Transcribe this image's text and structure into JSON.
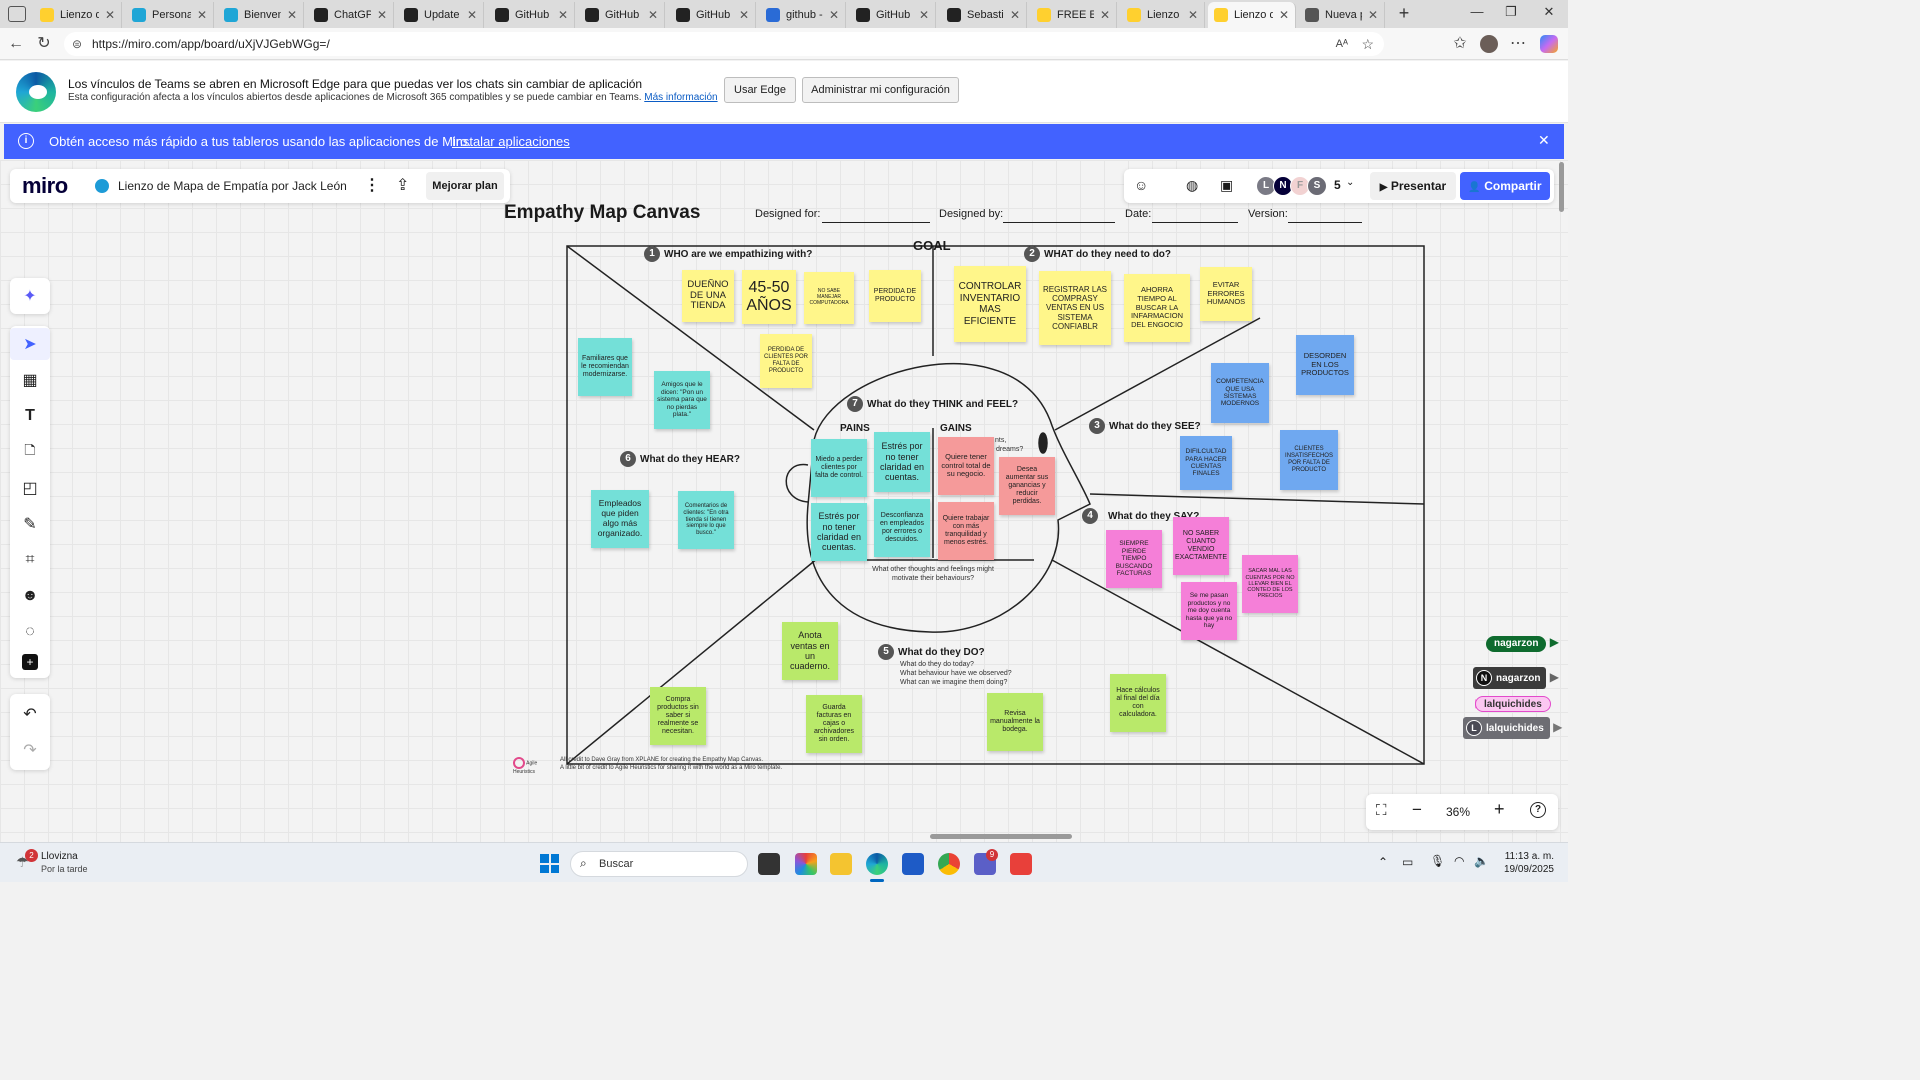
{
  "browser": {
    "tabs": [
      {
        "title": "Lienzo de",
        "icon": "miro-favicon",
        "color": "#ffd02f"
      },
      {
        "title": "Personali",
        "icon": "edge-favicon",
        "color": "#1fa6d6"
      },
      {
        "title": "Bienvenid",
        "icon": "edge-favicon",
        "color": "#1fa6d6"
      },
      {
        "title": "ChatGPT",
        "icon": "chatgpt-favicon",
        "color": "#222222"
      },
      {
        "title": "Update h",
        "icon": "github-favicon",
        "color": "#222222"
      },
      {
        "title": "GitHub -",
        "icon": "github-favicon",
        "color": "#222222"
      },
      {
        "title": "GitHub -",
        "icon": "github-favicon",
        "color": "#222222"
      },
      {
        "title": "GitHub -",
        "icon": "github-favicon",
        "color": "#222222"
      },
      {
        "title": "github - E",
        "icon": "search-favicon",
        "color": "#2a6bd6"
      },
      {
        "title": "GitHub",
        "icon": "github-favicon",
        "color": "#222222"
      },
      {
        "title": "Sebastian",
        "icon": "github-favicon",
        "color": "#222222"
      },
      {
        "title": "FREE Emp",
        "icon": "miro-favicon",
        "color": "#ffd02f"
      },
      {
        "title": "Lienzo de",
        "icon": "miro-favicon",
        "color": "#ffd02f"
      },
      {
        "title": "Lienzo de",
        "icon": "miro-favicon",
        "color": "#ffd02f"
      },
      {
        "title": "Nueva pe",
        "icon": "newtab-favicon",
        "color": "#555555"
      }
    ],
    "url": "https://miro.com/app/board/uXjVJGebWGg=/"
  },
  "teams_banner": {
    "title": "Los vínculos de Teams se abren en Microsoft Edge para que puedas ver los chats sin cambiar de aplicación",
    "body": "Esta configuración afecta a los vínculos abiertos desde aplicaciones de Microsoft 365 compatibles y se puede cambiar en Teams.",
    "link": "Más información",
    "use_edge": "Usar Edge",
    "manage": "Administrar mi configuración"
  },
  "miro_banner": {
    "text": "Obtén acceso más rápido a tus tableros usando las aplicaciones de Miro.",
    "link": "Instalar aplicaciones"
  },
  "board": {
    "logo": "miro",
    "title": "Lienzo de Mapa de Empatía por Jack León",
    "upgrade": "Mejorar plan",
    "avatars": [
      "L",
      "N",
      "F",
      "S"
    ],
    "user_count": "5",
    "present": "Presentar",
    "share": "Compartir"
  },
  "template": {
    "title": "Empathy Map Canvas",
    "designed_for": "Designed for:",
    "designed_by": "Designed by:",
    "date": "Date:",
    "version": "Version:",
    "goal": "GOAL",
    "s1": {
      "n": "1",
      "label": "WHO are we empathizing with?"
    },
    "s2": {
      "n": "2",
      "label": "WHAT do they need to do?"
    },
    "s3": {
      "n": "3",
      "label": "What do they SEE?"
    },
    "s4": {
      "n": "4",
      "label": "What do they SAY?"
    },
    "s5": {
      "n": "5",
      "label": "What do they DO?"
    },
    "s5_sub": [
      "What do they do today?",
      "What behaviour have we observed?",
      "What can we imagine them doing?"
    ],
    "s6": {
      "n": "6",
      "label": "What do they HEAR?"
    },
    "s7": {
      "n": "7",
      "label": "What do they THINK and FEEL?"
    },
    "pains": "PAINS",
    "gains": "GAINS",
    "gains_hint1": "nts,",
    "gains_hint2": "dreams?",
    "think_bottom": "What other thoughts and feelings might motivate their behaviours?",
    "credit1": "All credit to Dave Gray from XPLANE for creating the Empathy Map Canvas.",
    "credit2": "A little bit of credit to Agile Heuristics for sharing it with the world as a Miro template.",
    "credit_logo": "Agile Heuristics"
  },
  "notes": {
    "who1": "DUEÑNO DE UNA TIENDA",
    "who2": "45-50 AÑOS",
    "who3": "NO SABE MANEJAR COMPUTADORA",
    "who4": "PERDIDA DE PRODUCTO",
    "who5": "PERDIDA DE CLIENTES POR FALTA DE PRODUCTO",
    "need1": "CONTROLAR INVENTARIO MAS EFICIENTE",
    "need2": "REGISTRAR LAS COMPRASY VENTAS EN US SISTEMA CONFIABLR",
    "need3": "AHORRA TIEMPO AL BUSCAR LA INFARMACION DEL ENGOCIO",
    "need4": "EVITAR ERRORES HUMANOS",
    "see1": "COMPETENCIA QUE USA SISTEMAS MODERNOS",
    "see2": "DESORDEN EN LOS PRODUCTOS",
    "see3": "DIFILCULTAD PARA HACER CUENTAS FINALES",
    "see4": "CLIENTES INSATISFECHOS POR FALTA DE PRODUCTO",
    "hear1": "Familiares que le recomiendan modernizarse.",
    "hear2": "Amigos que le dicen: \"Pon un sistema para que no pierdas plata.\"",
    "hear3": "Empleados que piden algo más organizado.",
    "hear4": "Comentarios de clientes: \"En otra tienda sí tienen siempre lo que busco.\"",
    "pain1": "Miedo a perder clientes por falta de control.",
    "pain2": "Estrés por no tener claridad en cuentas.",
    "pain3": "Estrés por no tener claridad en cuentas.",
    "pain4": "Desconfianza en empleados por errores o descuidos.",
    "gain1": "Quiere tener control total de su negocio.",
    "gain2": "Desea aumentar sus ganancias y reducir perdidas.",
    "gain3": "Quiere trabajar con más tranquilidad y menos estrés.",
    "say1": "SIEMPRE PIERDE TIEMPO BUSCANDO FACTURAS",
    "say2": "NO SABER CUANTO VENDIO EXACTAMENTE",
    "say3": "SACAR MAL LAS CUENTAS POR NO LLEVAR BIEN EL CONTEO DE LOS PRECIOS",
    "say4": "Se me pasan productos y no me doy cuenta hasta que ya no hay",
    "do1": "Anota ventas en un cuaderno.",
    "do2": "Compra productos sin saber si realmente se necesitan.",
    "do3": "Guarda facturas en cajas o archivadores sin orden.",
    "do4": "Revisa manualmente la bodega.",
    "do5": "Hace cálculos al final del día con calculadora."
  },
  "cursors": [
    {
      "label": "nagarzon"
    },
    {
      "label": "nagarzon",
      "avatar": "N"
    },
    {
      "label": "lalquichides"
    },
    {
      "label": "lalquichides",
      "avatar": "L"
    }
  ],
  "zoom": "36%",
  "taskbar": {
    "weather_temp_badge": "2",
    "weather": "Llovizna",
    "weather_sub": "Por la tarde",
    "search": "Buscar",
    "teams_badge": "9",
    "time": "11:13 a. m.",
    "date": "19/09/2025"
  }
}
